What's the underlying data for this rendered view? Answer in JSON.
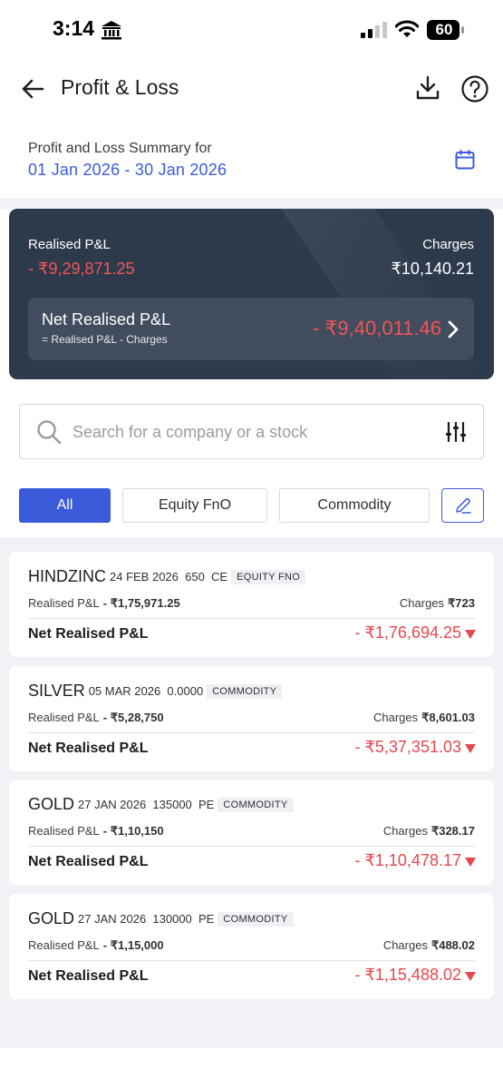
{
  "status_bar": {
    "time": "3:14",
    "battery": "60"
  },
  "header": {
    "title": "Profit & Loss"
  },
  "summary": {
    "label": "Profit and Loss Summary for",
    "date_range": "01 Jan 2026 - 30 Jan 2026"
  },
  "overview": {
    "realised_label": "Realised P&L",
    "realised_value": "- ₹9,29,871.25",
    "charges_label": "Charges",
    "charges_value": "₹10,140.21",
    "net_label": "Net Realised P&L",
    "net_formula": "= Realised P&L - Charges",
    "net_value": "- ₹9,40,011.46"
  },
  "search": {
    "placeholder": "Search for a company or a stock"
  },
  "filters": {
    "all": "All",
    "equity_fno": "Equity FnO",
    "commodity": "Commodity",
    "active": "All"
  },
  "positions": [
    {
      "symbol": "HINDZINC",
      "meta": "24 FEB 2026  650  CE",
      "tag": "EQUITY FNO",
      "realised_label": "Realised P&L",
      "realised_value": "- ₹1,75,971.25",
      "charges_label": "Charges",
      "charges_value": "₹723",
      "net_label": "Net Realised P&L",
      "net_value": "- ₹1,76,694.25"
    },
    {
      "symbol": "SILVER",
      "meta": "05 MAR 2026  0.0000",
      "tag": "COMMODITY",
      "realised_label": "Realised P&L",
      "realised_value": "- ₹5,28,750",
      "charges_label": "Charges",
      "charges_value": "₹8,601.03",
      "net_label": "Net Realised P&L",
      "net_value": "- ₹5,37,351.03"
    },
    {
      "symbol": "GOLD",
      "meta": "27 JAN 2026  135000  PE",
      "tag": "COMMODITY",
      "realised_label": "Realised P&L",
      "realised_value": "- ₹1,10,150",
      "charges_label": "Charges",
      "charges_value": "₹328.17",
      "net_label": "Net Realised P&L",
      "net_value": "- ₹1,10,478.17"
    },
    {
      "symbol": "GOLD",
      "meta": "27 JAN 2026  130000  PE",
      "tag": "COMMODITY",
      "realised_label": "Realised P&L",
      "realised_value": "- ₹1,15,000",
      "charges_label": "Charges",
      "charges_value": "₹488.02",
      "net_label": "Net Realised P&L",
      "net_value": "- ₹1,15,488.02"
    }
  ],
  "colors": {
    "accent": "#3b5bdb",
    "loss": "#e5484d",
    "card_dark": "#2d3a4c"
  },
  "icons": [
    "bank-icon",
    "signal-icon",
    "wifi-icon",
    "battery-icon",
    "back-arrow-icon",
    "download-icon",
    "help-icon",
    "calendar-icon",
    "chevron-right-icon",
    "search-icon",
    "filter-sliders-icon",
    "pencil-icon",
    "caret-down-icon"
  ]
}
